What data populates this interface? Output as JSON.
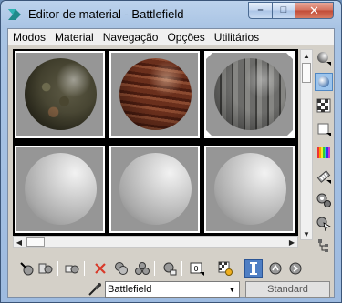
{
  "window": {
    "title": "Editor de material - Battlefield",
    "min_glyph": "–",
    "max_glyph": "□",
    "close_glyph": "✕"
  },
  "menu": {
    "items": [
      {
        "label": "Modos"
      },
      {
        "label": "Material"
      },
      {
        "label": "Navegação"
      },
      {
        "label": "Opções"
      },
      {
        "label": "Utilitários"
      }
    ]
  },
  "slots": [
    {
      "kind": "textured",
      "texture": "mossy-rock",
      "active": false
    },
    {
      "kind": "textured",
      "texture": "wood",
      "active": false
    },
    {
      "kind": "textured",
      "texture": "metal-plank",
      "active": false
    },
    {
      "kind": "default",
      "texture": "gray",
      "active": false
    },
    {
      "kind": "default",
      "texture": "gray",
      "active": false
    },
    {
      "kind": "default",
      "texture": "gray",
      "active": false
    }
  ],
  "side_tools": [
    {
      "name": "sample-type-icon"
    },
    {
      "name": "backlight-icon"
    },
    {
      "name": "background-icon"
    },
    {
      "name": "sample-uv-tiling-icon"
    },
    {
      "name": "video-color-check-icon"
    },
    {
      "name": "make-preview-icon"
    },
    {
      "name": "options-icon"
    },
    {
      "name": "select-by-material-icon"
    },
    {
      "name": "material-map-navigator-icon"
    }
  ],
  "bottom_tools": [
    {
      "name": "get-material-icon"
    },
    {
      "name": "put-material-to-scene-icon"
    },
    {
      "name": "assign-material-icon"
    },
    {
      "name": "reset-map-icon"
    },
    {
      "name": "copy-material-icon"
    },
    {
      "name": "make-unique-icon"
    },
    {
      "name": "put-to-library-icon"
    },
    {
      "name": "material-id-channel-icon"
    },
    {
      "name": "show-shaded-material-icon"
    },
    {
      "name": "show-end-result-icon"
    },
    {
      "name": "go-to-parent-icon"
    },
    {
      "name": "go-forward-to-sibling-icon"
    }
  ],
  "namebar": {
    "material_name": "Battlefield",
    "type_button": "Standard",
    "dropdown_glyph": "▼"
  },
  "scroll": {
    "up_glyph": "▲",
    "down_glyph": "▼",
    "left_glyph": "◀",
    "right_glyph": "▶"
  },
  "colors": {
    "reset_icon_red": "#d83a2a",
    "active_tool_blue": "#4f7fc4"
  }
}
